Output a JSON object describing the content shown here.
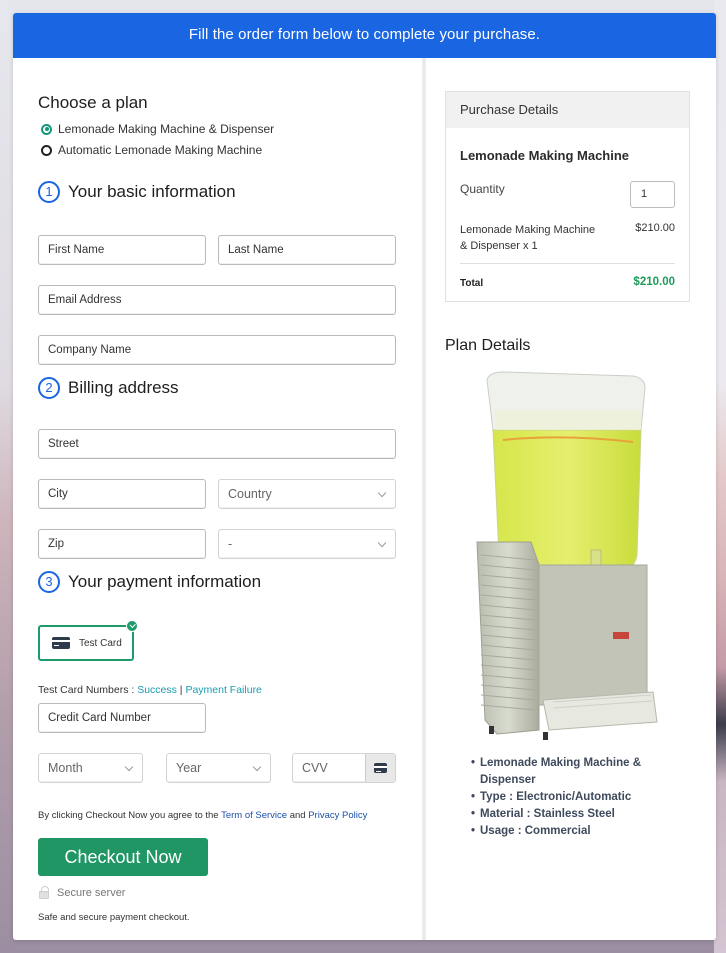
{
  "banner": {
    "text": "Fill the order form below to complete your purchase."
  },
  "plan": {
    "heading": "Choose a plan",
    "options": [
      {
        "label": "Lemonade Making Machine & Dispenser",
        "selected": true
      },
      {
        "label": "Automatic Lemonade Making Machine",
        "selected": false
      }
    ]
  },
  "basic_info": {
    "step": "1",
    "heading": "Your basic information",
    "first_name_placeholder": "First Name",
    "last_name_placeholder": "Last Name",
    "email_placeholder": "Email Address",
    "company_placeholder": "Company Name"
  },
  "billing": {
    "step": "2",
    "heading": "Billing address",
    "street_placeholder": "Street",
    "city_placeholder": "City",
    "country_selected": "Country",
    "zip_placeholder": "Zip",
    "state_selected": "-"
  },
  "payment": {
    "step": "3",
    "heading": "Your payment information",
    "method_label": "Test Card",
    "test_numbers_label": "Test Card Numbers : ",
    "success_link": "Success",
    "separator": " | ",
    "failure_link": "Payment Failure",
    "card_number_placeholder": "Credit Card Number",
    "month_selected": "Month",
    "year_selected": "Year",
    "cvv_placeholder": "CVV"
  },
  "terms": {
    "prefix": "By clicking Checkout Now you agree to the ",
    "tos_link": "Term of Service",
    "and": " and ",
    "privacy_link": "Privacy Policy"
  },
  "checkout": {
    "button_label": "Checkout Now",
    "secure_label": "Secure server",
    "safe_note": "Safe and secure payment checkout."
  },
  "purchase_details": {
    "heading": "Purchase Details",
    "product_title": "Lemonade Making Machine",
    "quantity_label": "Quantity",
    "quantity_value": "1",
    "line_item": "Lemonade Making Machine & Dispenser x 1",
    "line_price": "$210.00",
    "total_label": "Total",
    "total_value": "$210.00"
  },
  "plan_details": {
    "heading": "Plan Details",
    "image_alt": "Lemonade dispenser machine",
    "bullets": [
      "Lemonade Making Machine & Dispenser",
      "Type : Electronic/Automatic",
      "Material : Stainless Steel",
      "Usage : Commercial"
    ]
  },
  "colors": {
    "banner_blue": "#1a66e2",
    "checkout_green": "#1f9663",
    "total_green": "#1e9b5a",
    "link_teal": "#1a9bb0",
    "link_blue": "#1d4fa8"
  }
}
